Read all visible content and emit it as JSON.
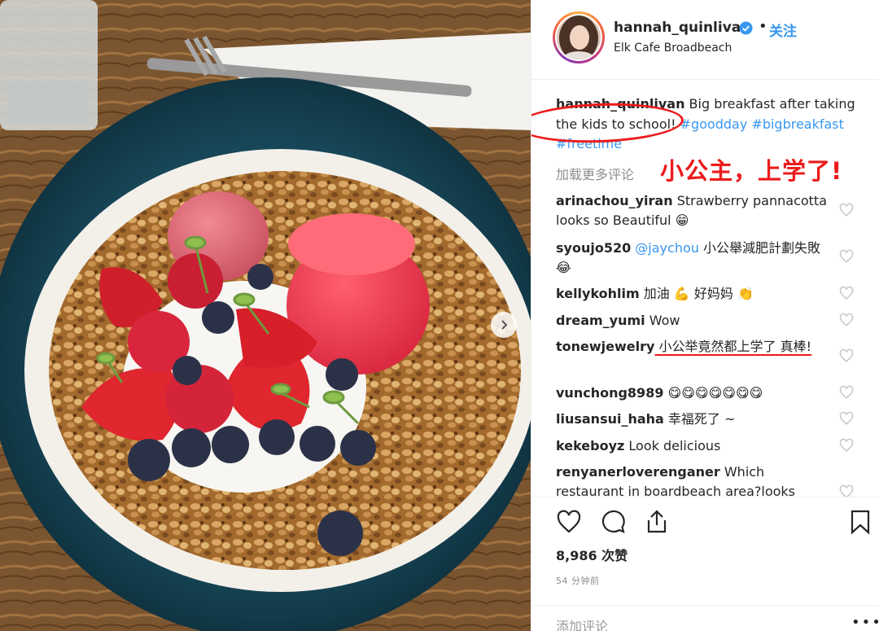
{
  "post": {
    "username": "hannah_quinlivan",
    "follow_label": "关注",
    "location": "Elk Cafe Broadbeach",
    "caption_user": "hannah_quinlivan",
    "caption_text": " Big breakfast after taking the kids to school! ",
    "hashtags": [
      "#goodday",
      "#bigbreakfast",
      "#freetime"
    ],
    "load_more": "加载更多评论",
    "annotation": "小公主，上学了!"
  },
  "comments": [
    {
      "user": "arinachou_yiran",
      "text": " Strawberry pannacotta looks so Beautiful 😁"
    },
    {
      "user": "syoujo520",
      "mention": " @jaychou",
      "text": " 小公舉減肥計劃失敗😂"
    },
    {
      "user": "kellykohlim",
      "text": " 加油 💪 好妈妈 👏"
    },
    {
      "user": "dream_yumi",
      "text": " Wow"
    },
    {
      "user": "tonewjewelry",
      "text": " 小公举竟然都上学了 真棒!"
    },
    {
      "user": "vunchong8989",
      "text": " 😋😋😋😋😋😋😋"
    },
    {
      "user": "liusansui_haha",
      "text": " 幸福死了 ~"
    },
    {
      "user": "kekeboyz",
      "text": " Look delicious"
    },
    {
      "user": "renyanerloverenganer",
      "text": " Which restaurant in boardbeach area?looks"
    }
  ],
  "stats": {
    "likes": "8,986 次赞",
    "time": "54 分钟前",
    "add_comment": "添加评论",
    "more": "•••"
  },
  "colors": {
    "accent": "#3897f0",
    "annotation_red": "#ec1b1b",
    "text": "#262626",
    "muted": "#8e8e8e"
  }
}
